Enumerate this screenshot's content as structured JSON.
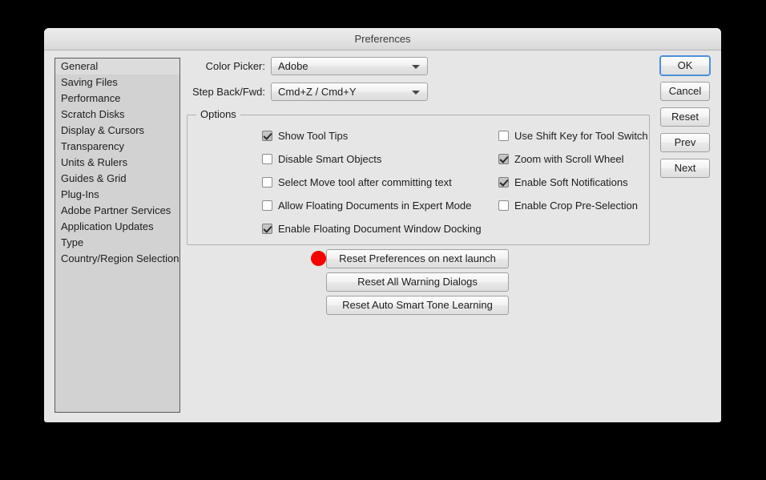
{
  "window": {
    "title": "Preferences"
  },
  "sidebar": {
    "selected_index": 0,
    "items": [
      {
        "label": "General"
      },
      {
        "label": "Saving Files"
      },
      {
        "label": "Performance"
      },
      {
        "label": "Scratch Disks"
      },
      {
        "label": "Display & Cursors"
      },
      {
        "label": "Transparency"
      },
      {
        "label": "Units & Rulers"
      },
      {
        "label": "Guides & Grid"
      },
      {
        "label": "Plug-Ins"
      },
      {
        "label": "Adobe Partner Services"
      },
      {
        "label": "Application Updates"
      },
      {
        "label": "Type"
      },
      {
        "label": "Country/Region Selection"
      }
    ]
  },
  "fields": [
    {
      "label": "Color Picker:",
      "value": "Adobe",
      "icon": "chevron-down-icon"
    },
    {
      "label": "Step Back/Fwd:",
      "value": "Cmd+Z / Cmd+Y",
      "icon": "chevron-down-icon"
    }
  ],
  "options": {
    "legend": "Options",
    "left_column": [
      {
        "label": "Show Tool Tips",
        "checked": true
      },
      {
        "label": "Disable Smart Objects",
        "checked": false
      },
      {
        "label": "Select Move tool after committing text",
        "checked": false
      },
      {
        "label": "Allow Floating Documents in Expert Mode",
        "checked": false
      },
      {
        "label": "Enable Floating Document Window Docking",
        "checked": true
      }
    ],
    "right_column": [
      {
        "label": "Use Shift Key for Tool Switch",
        "checked": false
      },
      {
        "label": "Zoom with Scroll Wheel",
        "checked": true
      },
      {
        "label": "Enable Soft Notifications",
        "checked": true
      },
      {
        "label": "Enable Crop Pre-Selection",
        "checked": false
      }
    ]
  },
  "reset_buttons": [
    {
      "label": "Reset Preferences on next launch"
    },
    {
      "label": "Reset All Warning Dialogs"
    },
    {
      "label": "Reset Auto Smart Tone Learning"
    }
  ],
  "action_buttons": [
    {
      "label": "OK",
      "focused": true
    },
    {
      "label": "Cancel",
      "focused": false
    },
    {
      "label": "Reset",
      "focused": false
    },
    {
      "label": "Prev",
      "focused": false
    },
    {
      "label": "Next",
      "focused": false
    }
  ],
  "cursor": {
    "name": "click-marker",
    "color": "#f70000"
  }
}
